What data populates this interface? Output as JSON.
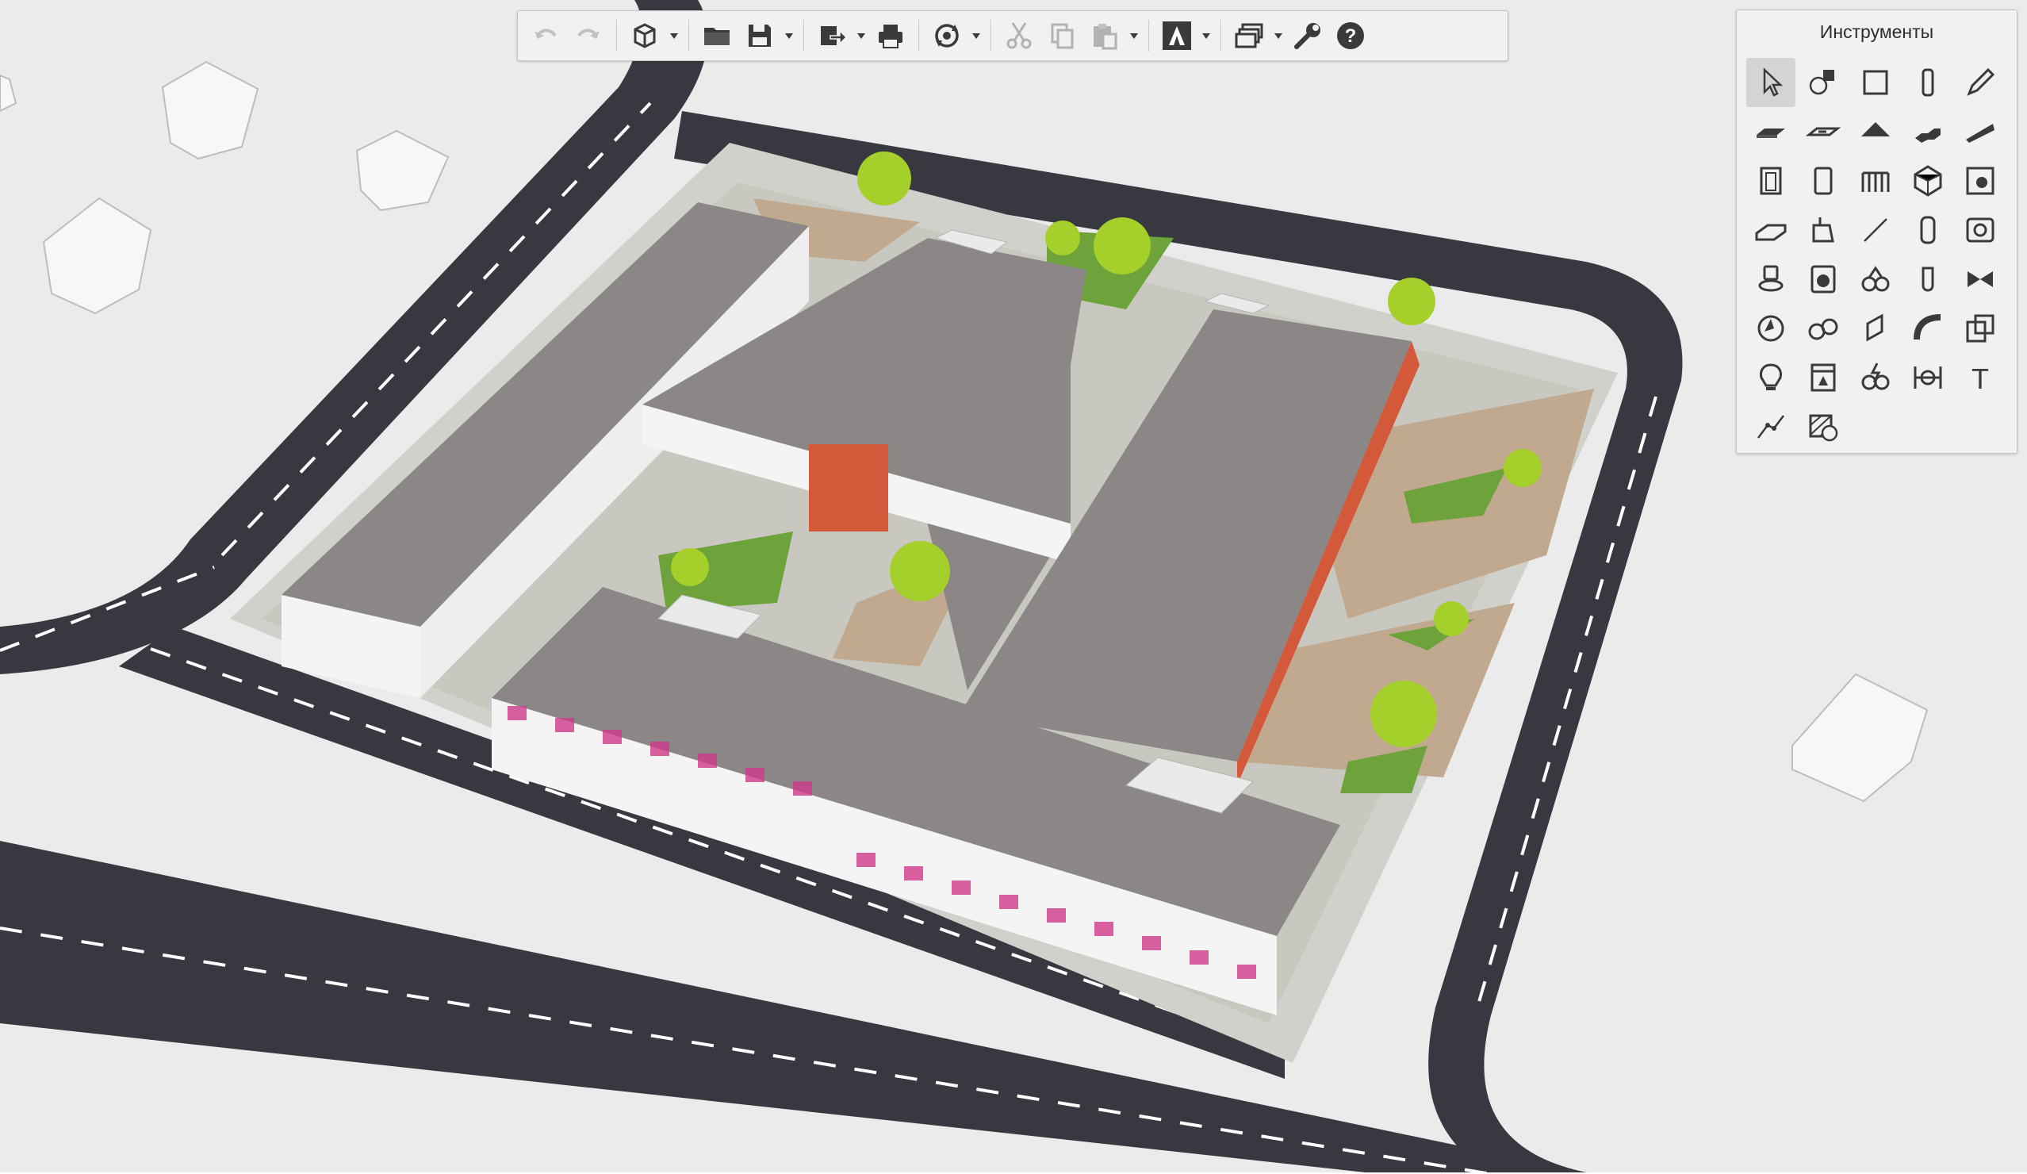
{
  "app": {
    "viewport_description_hidden": true
  },
  "toolbar": {
    "buttons": [
      {
        "id": "undo",
        "icon": "undo-icon",
        "enabled": false
      },
      {
        "id": "redo",
        "icon": "redo-icon",
        "enabled": false
      },
      {
        "id": "new-project",
        "icon": "cube-icon",
        "has_dropdown": true
      },
      {
        "id": "open",
        "icon": "folder-icon"
      },
      {
        "id": "save",
        "icon": "save-icon",
        "has_dropdown": true
      },
      {
        "id": "export",
        "icon": "export-icon",
        "has_dropdown": true
      },
      {
        "id": "print",
        "icon": "print-icon"
      },
      {
        "id": "collaboration",
        "icon": "sync-icon",
        "has_dropdown": true
      },
      {
        "id": "cut",
        "icon": "scissors-icon"
      },
      {
        "id": "copy",
        "icon": "copy-icon"
      },
      {
        "id": "paste",
        "icon": "paste-icon",
        "has_dropdown": true
      },
      {
        "id": "renga-logo",
        "icon": "renga-logo-icon",
        "has_dropdown": true
      },
      {
        "id": "views",
        "icon": "views-icon",
        "has_dropdown": true
      },
      {
        "id": "settings",
        "icon": "wrench-icon"
      },
      {
        "id": "help",
        "icon": "help-icon"
      }
    ]
  },
  "tools_panel": {
    "title": "Инструменты",
    "tools": [
      {
        "name": "select-icon",
        "active": true
      },
      {
        "name": "shapes-icon"
      },
      {
        "name": "wall-icon"
      },
      {
        "name": "column-icon"
      },
      {
        "name": "pencil-icon"
      },
      {
        "name": "floor-icon"
      },
      {
        "name": "slab-opening-icon"
      },
      {
        "name": "roof-icon"
      },
      {
        "name": "stairs-icon"
      },
      {
        "name": "ramp-icon"
      },
      {
        "name": "door-icon"
      },
      {
        "name": "window-icon"
      },
      {
        "name": "railing-icon"
      },
      {
        "name": "element-icon"
      },
      {
        "name": "room-icon"
      },
      {
        "name": "beam-icon"
      },
      {
        "name": "plumbing-fixture-icon"
      },
      {
        "name": "line-icon"
      },
      {
        "name": "pipe-fitting-icon"
      },
      {
        "name": "equipment-icon"
      },
      {
        "name": "toilet-icon"
      },
      {
        "name": "washer-icon"
      },
      {
        "name": "pipe-system-icon"
      },
      {
        "name": "pipe-icon"
      },
      {
        "name": "valve-icon"
      },
      {
        "name": "fan-icon"
      },
      {
        "name": "duct-system-icon"
      },
      {
        "name": "duct-icon"
      },
      {
        "name": "duct-bend-icon"
      },
      {
        "name": "duct-fitting-icon"
      },
      {
        "name": "lamp-icon"
      },
      {
        "name": "electrical-panel-icon"
      },
      {
        "name": "electric-system-icon"
      },
      {
        "name": "dimension-icon"
      },
      {
        "name": "text-icon",
        "glyph": "T"
      },
      {
        "name": "polyline-icon"
      },
      {
        "name": "hatch-icon"
      }
    ]
  },
  "colors": {
    "ground": "#e9e9e9",
    "road": "#3a3a42",
    "road_marking": "#ffffff",
    "sidewalk": "#d2d2cc",
    "roof": "#8a8786",
    "wall": "#f4f4f4",
    "accent_wall": "#d4593a",
    "lawn": "#6ea23a",
    "tree": "#a5cf2b",
    "sand": "#bfa98f"
  }
}
